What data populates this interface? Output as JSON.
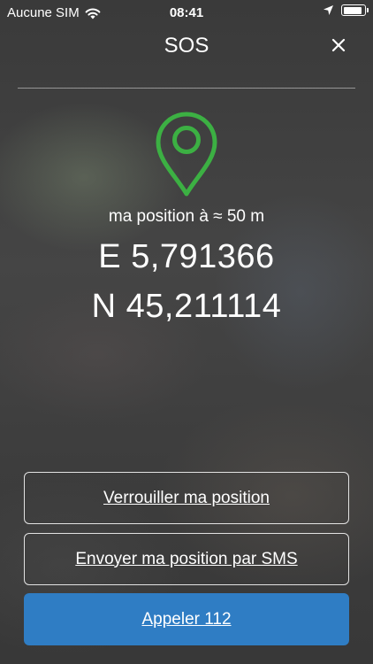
{
  "status_bar": {
    "carrier": "Aucune SIM",
    "time": "08:41"
  },
  "header": {
    "title": "SOS"
  },
  "location": {
    "precision": "ma position à ≈ 50 m",
    "east": "E 5,791366",
    "north": "N 45,211114"
  },
  "actions": {
    "lock_label": "Verrouiller ma position",
    "sms_label": "Envoyer ma position par SMS",
    "call_label": "Appeler 112"
  },
  "colors": {
    "pin": "#3cb043",
    "call_button": "#2f7dc4"
  }
}
